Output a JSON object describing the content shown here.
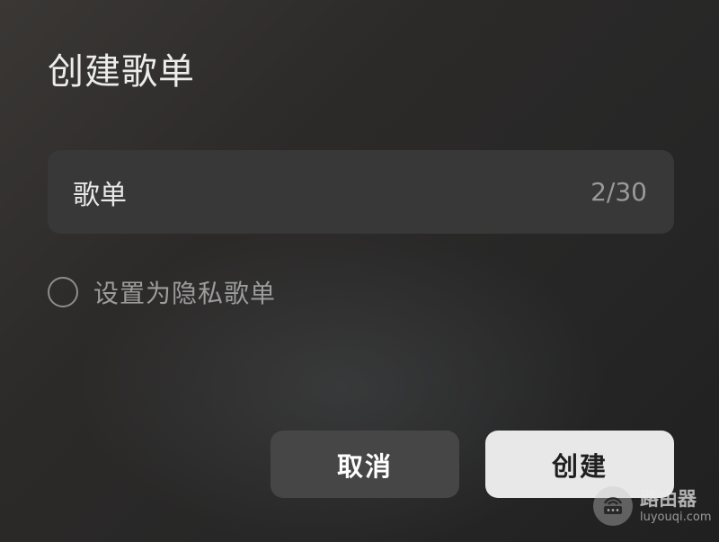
{
  "dialog": {
    "title": "创建歌单"
  },
  "name_field": {
    "value": "歌单",
    "char_count": "2/30"
  },
  "private_option": {
    "label": "设置为隐私歌单",
    "checked": false
  },
  "buttons": {
    "cancel_label": "取消",
    "create_label": "创建"
  },
  "watermark": {
    "text": "路由器",
    "subtext": "luyouqi.com",
    "icon": "router-logo-icon"
  },
  "colors": {
    "background": "#2a2929",
    "field_background": "#383838",
    "cancel_background": "#464646",
    "create_background": "#e8e8e8"
  }
}
